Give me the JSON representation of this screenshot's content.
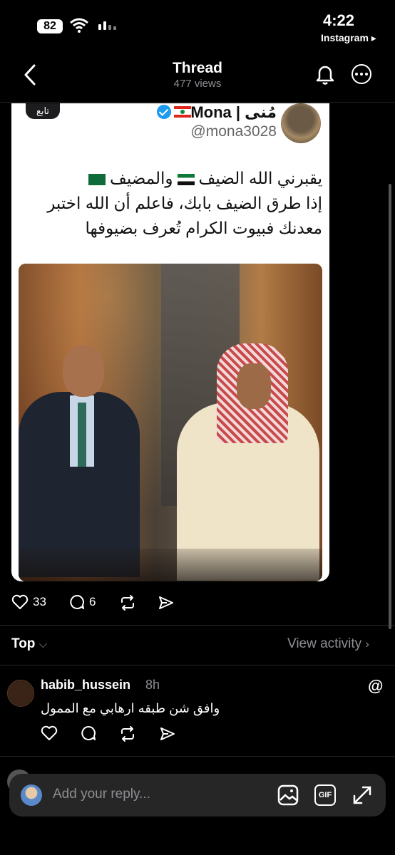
{
  "status_bar": {
    "battery": "82",
    "time": "4:22",
    "back_app": "Instagram ▸"
  },
  "nav": {
    "title": "Thread",
    "subtitle": "477 views"
  },
  "post": {
    "follow_label": "تابع",
    "profile_name": "Mona | مُنى",
    "handle": "@mona3028",
    "text_line1_a": "يقبرني الله الضيف",
    "text_line1_b": "والمضيف",
    "text_line2": "إذا طرق الضيف بابك، فاعلم أن الله اختبر",
    "text_line3": "معدنك فبيوت الكرام تُعرف بضيوفها",
    "likes": "33",
    "comments": "6"
  },
  "sort": {
    "label": "Top",
    "view_activity": "View activity"
  },
  "comment": {
    "username": "habib_hussein",
    "time": "8h",
    "text": "وافق شن طبقه ارهابي مع الممول"
  },
  "reply": {
    "placeholder": "Add your reply..."
  },
  "icons": {
    "like": "heart-icon",
    "comment": "comment-icon",
    "repost": "repost-icon",
    "share": "send-icon"
  }
}
